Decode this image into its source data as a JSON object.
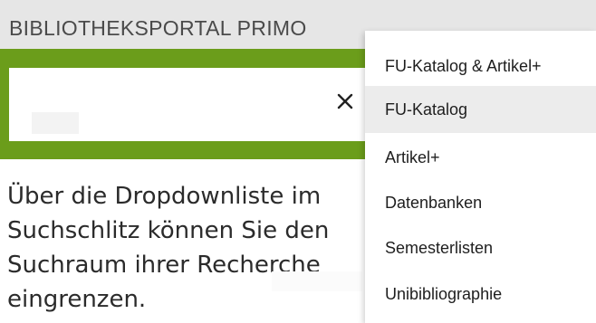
{
  "header": {
    "title": "BIBLIOTHEKSPORTAL PRIMO"
  },
  "search": {
    "value": "",
    "clear_icon": "close-icon"
  },
  "help_text": "Über die Dropdownliste im\nSuchschlitz können Sie den\nSuchraum ihrer Recherche\neingrenzen.",
  "scope_menu": {
    "items": [
      {
        "label": "FU-Katalog & Artikel+"
      },
      {
        "label": "FU-Katalog",
        "selected": true
      },
      {
        "label": "Artikel+"
      },
      {
        "label": "Datenbanken"
      },
      {
        "label": "Semesterlisten"
      },
      {
        "label": "Unibibliographie"
      }
    ]
  },
  "colors": {
    "search_frame": "#6b9d1b",
    "header_bar": "#e6e6e6",
    "selected_item": "#ececec"
  }
}
